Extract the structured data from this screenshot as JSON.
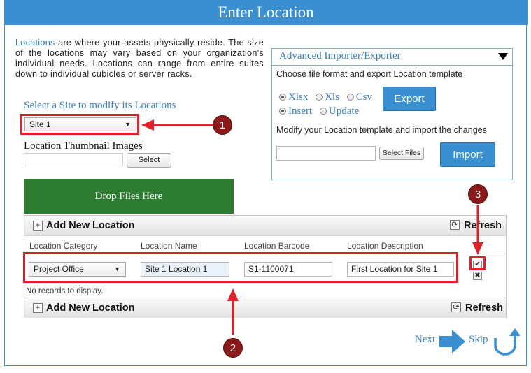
{
  "header": {
    "title": "Enter Location"
  },
  "intro": {
    "link_text": "Locations",
    "text": " are where your assets physically reside. The size of the locations may vary based on your organization's individual needs. Locations can range from entire suites down to individual cubicles or server racks."
  },
  "site": {
    "label": "Select a Site to modify its Locations",
    "selected": "Site 1"
  },
  "thumbnail": {
    "label": "Location Thumbnail Images",
    "input_value": "",
    "select_label": "Select"
  },
  "drop_zone": {
    "label": "Drop Files Here"
  },
  "importer": {
    "title": "Advanced Importer/Exporter",
    "export_instruction": "Choose file format and export Location template",
    "formats": [
      "Xlsx",
      "Xls",
      "Csv"
    ],
    "selected_format": "Xlsx",
    "modes": [
      "Insert",
      "Update"
    ],
    "selected_mode": "Insert",
    "export_label": "Export",
    "import_instruction": "Modify your Location template and import the changes",
    "file_value": "",
    "select_files_label": "Select Files",
    "import_label": "Import"
  },
  "grid": {
    "add_label": "Add New Location",
    "refresh_label": "Refresh",
    "columns": [
      "Location Category",
      "Location Name",
      "Location Barcode",
      "Location Description"
    ],
    "new_row": {
      "category": "Project Office",
      "name": "Site 1 Location 1",
      "barcode": "S1-1100071",
      "description": "First Location for Site 1"
    },
    "empty_message": "No records to display."
  },
  "annotations": {
    "badge_1": "1",
    "badge_2": "2",
    "badge_3": "3"
  },
  "nav": {
    "next_label": "Next",
    "skip_label": "Skip"
  },
  "colors": {
    "accent": "#3a8fd0",
    "highlight": "#e0202a",
    "badge": "#8b1a1a",
    "drop_zone": "#2e7d32"
  }
}
